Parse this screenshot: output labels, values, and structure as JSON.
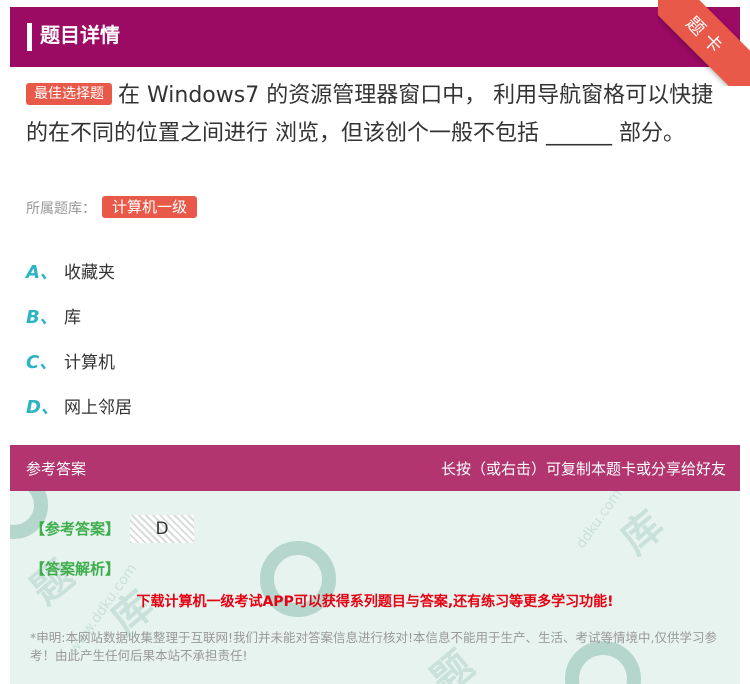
{
  "header": {
    "title": "题目详情",
    "ribbon": "题卡"
  },
  "question": {
    "tag": "最佳选择题",
    "text": "在 Windows7 的资源管理器窗口中， 利用导航窗格可以快捷的在不同的位置之间进行 浏览，但该创个一般不包括 ______ 部分。",
    "source_label": "所属题库：",
    "source_tag": "计算机一级"
  },
  "options": [
    {
      "letter": "A、",
      "text": "收藏夹"
    },
    {
      "letter": "B、",
      "text": "库"
    },
    {
      "letter": "C、",
      "text": "计算机"
    },
    {
      "letter": "D、",
      "text": "网上邻居"
    }
  ],
  "answer": {
    "head_left": "参考答案",
    "head_right": "长按（或右击）可复制本题卡或分享给好友",
    "answer_label": "【参考答案】",
    "answer_value": "D",
    "analysis_label": "【答案解析】",
    "promo": "下载计算机一级考试APP可以获得系列题目与答案,还有练习等更多学习功能!",
    "disclaimer": "*申明:本网站数据收集整理于互联网!我们并未能对答案信息进行核对!本信息不能用于生产、生活、考试等情境中,仅供学习参考！由此产生任何后果本站不承担责任!"
  },
  "colors": {
    "header": "#9b0a63",
    "answer_head": "#b3356f",
    "tag": "#e8594a",
    "option_letter": "#2cb4c4",
    "answer_label": "#3eae4c",
    "promo": "#e60012"
  }
}
